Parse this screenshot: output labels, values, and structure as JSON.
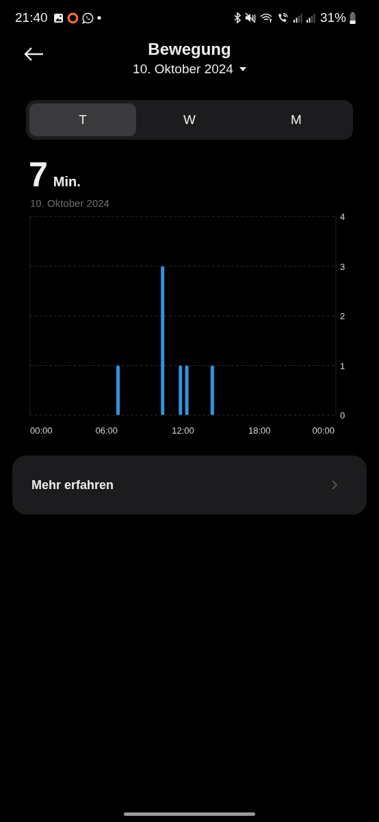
{
  "status_bar": {
    "time": "21:40",
    "battery": "31%"
  },
  "header": {
    "title": "Bewegung",
    "date": "10. Oktober 2024"
  },
  "tabs": [
    {
      "label": "T",
      "selected": true
    },
    {
      "label": "W",
      "selected": false
    },
    {
      "label": "M",
      "selected": false
    }
  ],
  "summary": {
    "value": "7",
    "unit": "Min.",
    "date": "10. Oktober 2024"
  },
  "chart_data": {
    "type": "bar",
    "x": [
      6.9,
      10.4,
      11.8,
      12.3,
      14.3
    ],
    "series": [
      {
        "color": "#2f95e0",
        "values": [
          1,
          3,
          1,
          1,
          1
        ]
      }
    ],
    "grid": true,
    "xlim": [
      0,
      24
    ],
    "ylim": [
      0,
      4
    ],
    "xticks": [
      {
        "value": 0,
        "label": "00:00"
      },
      {
        "value": 6,
        "label": "06:00"
      },
      {
        "value": 12,
        "label": "12:00"
      },
      {
        "value": 18,
        "label": "18:00"
      },
      {
        "value": 24,
        "label": "00:00"
      }
    ],
    "yticks": [
      0,
      1,
      2,
      3,
      4
    ]
  },
  "more_card": {
    "label": "Mehr erfahren"
  }
}
